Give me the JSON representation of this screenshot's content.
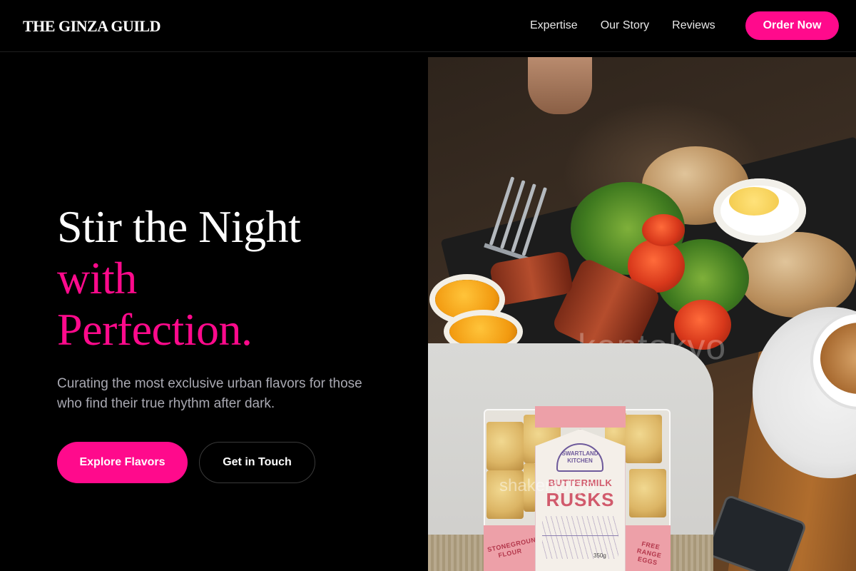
{
  "header": {
    "logo": "THE GINZA GUILD",
    "nav": [
      {
        "label": "Expertise"
      },
      {
        "label": "Our Story"
      },
      {
        "label": "Reviews"
      }
    ],
    "cta": "Order Now"
  },
  "hero": {
    "title_line1": "Stir the Night",
    "title_line2": "with",
    "title_line3": "Perfection.",
    "subtitle": "Curating the most exclusive urban flavors for those who find their true rhythm after dark.",
    "primary_button": "Explore Flavors",
    "secondary_button": "Get in Touch"
  },
  "images": {
    "main_watermark": "kentokyo",
    "product": {
      "brand": "SWARTLAND KITCHEN",
      "name_line1": "BUTTERMILK",
      "name_line2": "RUSKS",
      "left_band": "STONEGROUND FLOUR",
      "right_band": "FREE RANGE EGGS",
      "weight": "350g",
      "watermark": "shakentokyo"
    }
  },
  "colors": {
    "accent": "#ff0a8c",
    "background": "#000000",
    "subtitle": "#a9a9b2"
  }
}
